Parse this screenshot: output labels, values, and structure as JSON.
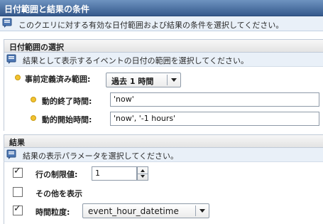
{
  "window": {
    "title": "日付範囲と結果の条件"
  },
  "intro": {
    "text": "このクエリに対する有効な日付範囲および結果の条件を選択してください。"
  },
  "date_section": {
    "header": "日付範囲の選択",
    "info": "結果として表示するイベントの日付の範囲を選択してください。",
    "predefined_label": "事前定義済み範囲:",
    "predefined_value": "過去 1 時間",
    "end_label": "動的終了時間:",
    "end_value": "'now'",
    "start_label": "動的開始時間:",
    "start_value": "'now', '-1 hours'"
  },
  "results_section": {
    "header": "結果",
    "info": "結果の表示パラメータを選択してください。",
    "row_limit_label": "行の制限値:",
    "row_limit_value": "1",
    "row_limit_checked": true,
    "show_other_label": "その他を表示",
    "show_other_checked": false,
    "granularity_label": "時間粒度:",
    "granularity_value": "event_hour_datetime",
    "granularity_checked": true
  }
}
